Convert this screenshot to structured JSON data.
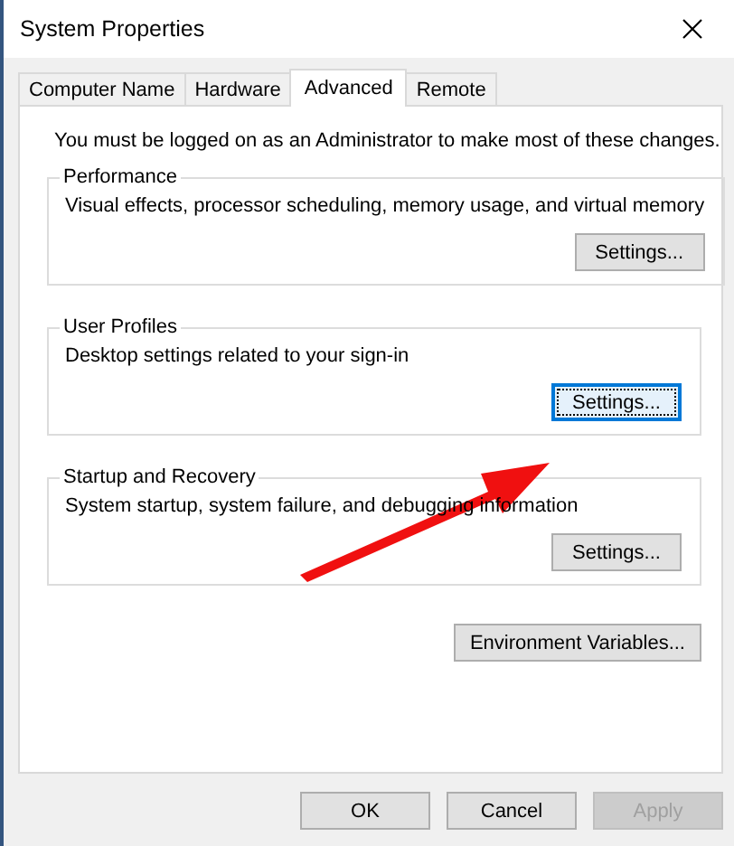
{
  "window": {
    "title": "System Properties"
  },
  "tabs": [
    {
      "label": "Computer Name",
      "selected": false
    },
    {
      "label": "Hardware",
      "selected": false
    },
    {
      "label": "Advanced",
      "selected": true
    },
    {
      "label": "Remote",
      "selected": false
    }
  ],
  "notice": "You must be logged on as an Administrator to make most of these changes.",
  "groups": [
    {
      "title": "Performance",
      "description": "Visual effects, processor scheduling, memory usage, and virtual memory",
      "button": {
        "label": "Settings...",
        "focused": false
      }
    },
    {
      "title": "User Profiles",
      "description": "Desktop settings related to your sign-in",
      "button": {
        "label": "Settings...",
        "focused": true
      }
    },
    {
      "title": "Startup and Recovery",
      "description": "System startup, system failure, and debugging information",
      "button": {
        "label": "Settings...",
        "focused": false
      }
    }
  ],
  "environment_button": {
    "label": "Environment Variables..."
  },
  "dialog_buttons": [
    {
      "label": "OK",
      "disabled": false
    },
    {
      "label": "Cancel",
      "disabled": false
    },
    {
      "label": "Apply",
      "disabled": true
    }
  ]
}
